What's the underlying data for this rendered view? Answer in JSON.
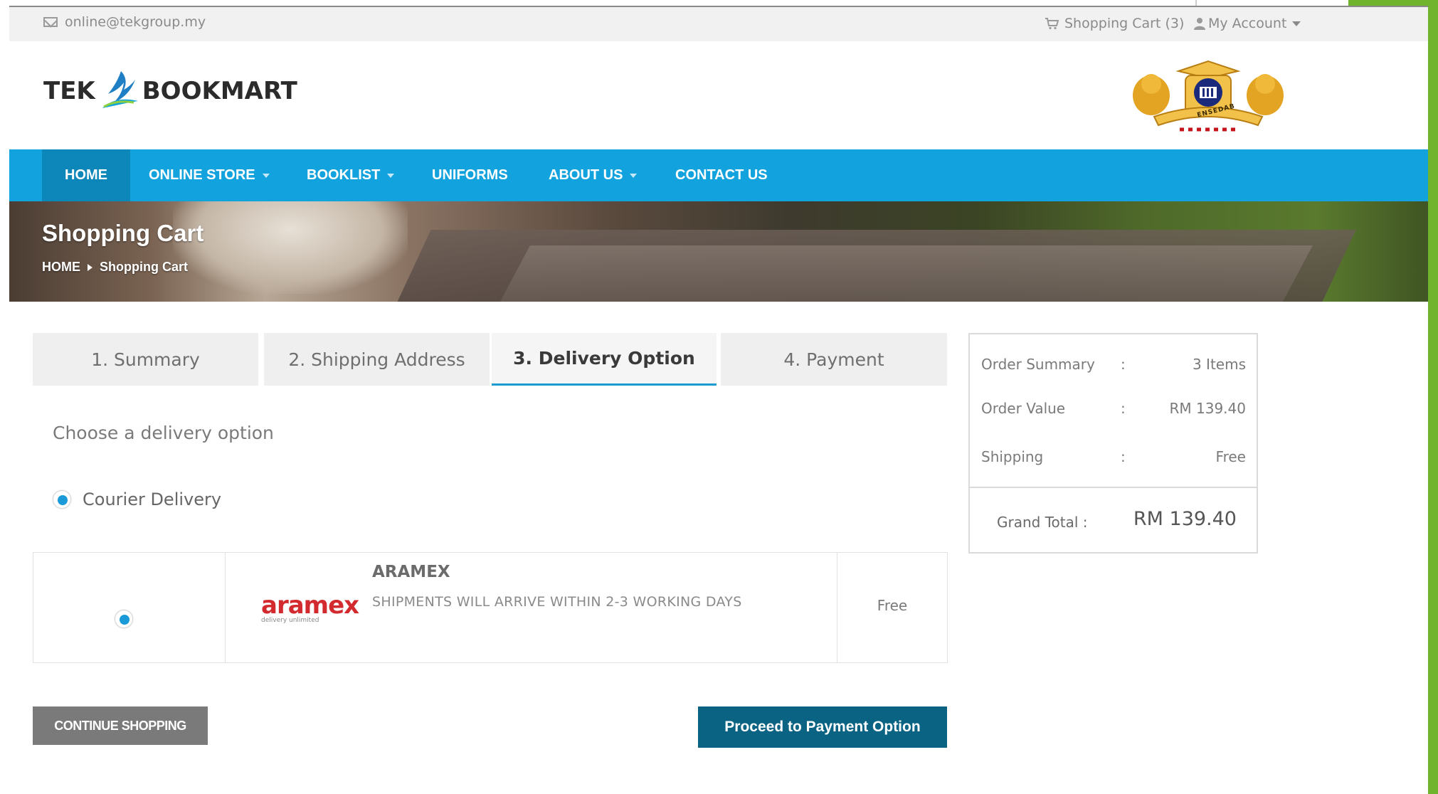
{
  "topbar": {
    "email": "online@tekgroup.my",
    "cart": "Shopping Cart (3)",
    "account": "My Account"
  },
  "brand": {
    "word_left": "TEK",
    "word_right": "BOOKMART",
    "crest_text": "ENSEDAB"
  },
  "nav": {
    "items": [
      {
        "label": "HOME",
        "active": true,
        "dropdown": false
      },
      {
        "label": "ONLINE STORE",
        "active": false,
        "dropdown": true
      },
      {
        "label": "BOOKLIST",
        "active": false,
        "dropdown": true
      },
      {
        "label": "UNIFORMS",
        "active": false,
        "dropdown": false
      },
      {
        "label": "ABOUT US",
        "active": false,
        "dropdown": true
      },
      {
        "label": "CONTACT US",
        "active": false,
        "dropdown": false
      }
    ]
  },
  "banner": {
    "title": "Shopping Cart",
    "breadcrumb": [
      "HOME",
      "Shopping Cart"
    ]
  },
  "steps": [
    {
      "label": "1. Summary",
      "active": false
    },
    {
      "label": "2. Shipping Address",
      "active": false
    },
    {
      "label": "3. Delivery Option",
      "active": true
    },
    {
      "label": "4. Payment",
      "active": false
    }
  ],
  "delivery": {
    "heading": "Choose a delivery option",
    "method": "Courier Delivery",
    "carrier": {
      "logo_word": "aramex",
      "logo_tagline": "delivery unlimited",
      "name": "ARAMEX",
      "description": "SHIPMENTS WILL ARRIVE WITHIN 2-3 WORKING DAYS",
      "fee": "Free"
    }
  },
  "buttons": {
    "continue": "CONTINUE SHOPPING",
    "proceed": "Proceed to Payment Option"
  },
  "summary": {
    "rows": [
      {
        "label": "Order Summary",
        "value": "3 Items"
      },
      {
        "label": "Order Value",
        "value": "RM 139.40"
      },
      {
        "label": "Shipping",
        "value": "Free"
      }
    ],
    "total_label": "Grand Total",
    "total_value": "RM 139.40"
  },
  "colors": {
    "nav_blue": "#12a2dd",
    "nav_active": "#0d86b9",
    "proceed_button": "#0b6384",
    "accent_green": "#6fb42c",
    "aramex_red": "#d22a2f"
  }
}
